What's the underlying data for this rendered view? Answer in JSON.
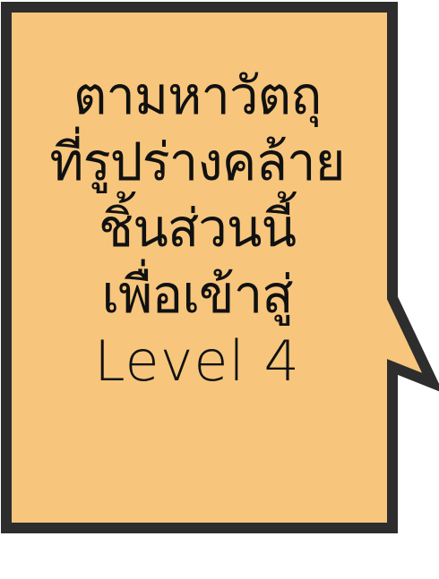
{
  "bubble": {
    "fill_color": "#f7c67c",
    "border_color": "#2d2d2d",
    "lines": [
      "ตามหาวัตถุ",
      "ที่รูปร่างคล้าย",
      "ชิ้นส่วนนี้",
      "เพื่อเข้าสู่",
      "Level 4"
    ]
  }
}
